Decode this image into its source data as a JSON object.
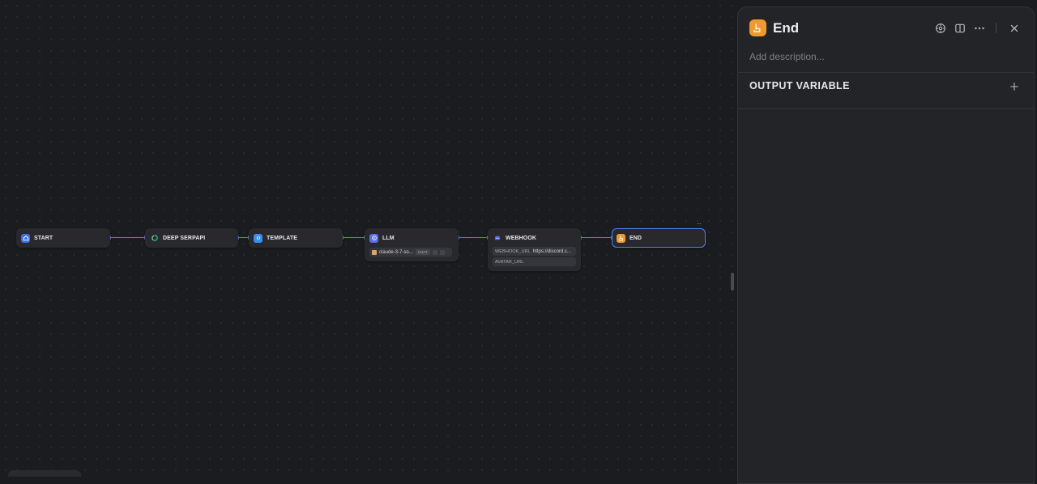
{
  "canvas": {
    "nodes": [
      {
        "id": "start",
        "title": "START",
        "icon": "home-icon",
        "color": "#3f6fe0"
      },
      {
        "id": "deep-serpapi",
        "title": "DEEP SERPAPI",
        "icon": "serpapi-icon",
        "color": "#2a9d6a"
      },
      {
        "id": "template",
        "title": "TEMPLATE",
        "icon": "template-icon",
        "color": "#3a8ef0"
      },
      {
        "id": "llm",
        "title": "LLM",
        "icon": "llm-icon",
        "color": "#5b6cf0",
        "model": "claude-3-7-so...",
        "mode": "CHAT"
      },
      {
        "id": "webhook",
        "title": "WEBHOOK",
        "icon": "discord-icon",
        "color": "#5865f2",
        "fields": [
          {
            "key": "WEBHOOK_URL",
            "value": "https://discord.c..."
          },
          {
            "key": "AVATAR_URL",
            "value": ""
          }
        ]
      },
      {
        "id": "end",
        "title": "END",
        "icon": "end-icon",
        "color": "#f09a2e",
        "selected": true
      }
    ],
    "node_menu": "..."
  },
  "panel": {
    "title": "End",
    "icon": "end-icon",
    "description_placeholder": "Add description...",
    "section_title": "OUTPUT VARIABLE",
    "actions": [
      "run-icon",
      "split-view-icon",
      "more-icon",
      "close-icon"
    ]
  }
}
